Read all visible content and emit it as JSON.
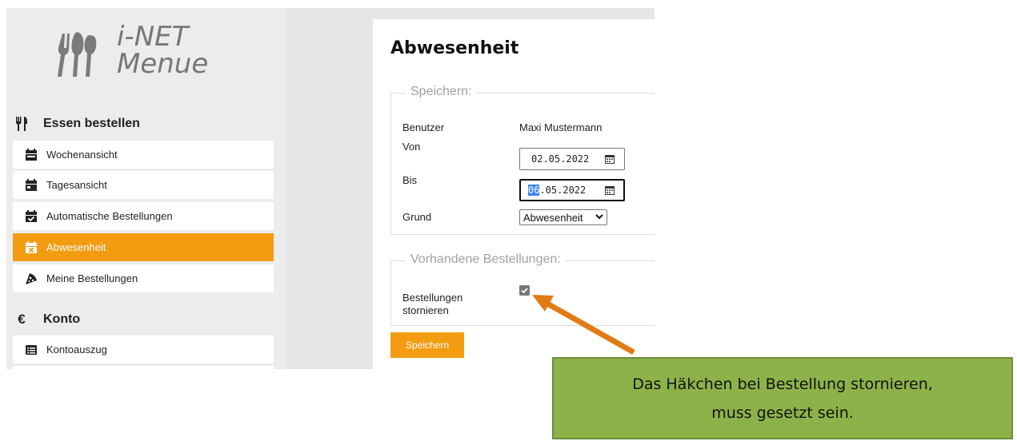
{
  "logo": {
    "line1": "i-NET",
    "line2": "Menue"
  },
  "sidebar": {
    "section_order": "Essen bestellen",
    "items": [
      {
        "label": "Wochenansicht",
        "icon": "calendar-week-icon"
      },
      {
        "label": "Tagesansicht",
        "icon": "calendar-day-icon"
      },
      {
        "label": "Automatische Bestellungen",
        "icon": "calendar-check-icon"
      },
      {
        "label": "Abwesenheit",
        "icon": "calendar-times-icon",
        "active": true
      },
      {
        "label": "Meine Bestellungen",
        "icon": "pizza-slice-icon"
      }
    ],
    "section_account": "Konto",
    "account_items": [
      {
        "label": "Kontoauszug",
        "icon": "list-alt-icon"
      }
    ]
  },
  "form": {
    "title": "Abwesenheit",
    "save_legend": "Speichern:",
    "user_label": "Benutzer",
    "user_value": "Maxi Mustermann",
    "from_label": "Von",
    "from_value": "02.05.2022",
    "to_label": "Bis",
    "to_value_selected": "06",
    "to_value_rest": ".05.2022",
    "reason_label": "Grund",
    "reason_value": "Abwesenheit",
    "orders_legend": "Vorhandene Bestellungen:",
    "cancel_label_1": "Bestellungen",
    "cancel_label_2": "stornieren",
    "cancel_checked": true,
    "save_button": "Speichern"
  },
  "callout": {
    "line1": "Das Häkchen bei Bestellung stornieren,",
    "line2": "muss gesetzt sein."
  },
  "colors": {
    "accent": "#f39c12",
    "callout_bg": "#8db249",
    "arrow": "#e07b16"
  }
}
